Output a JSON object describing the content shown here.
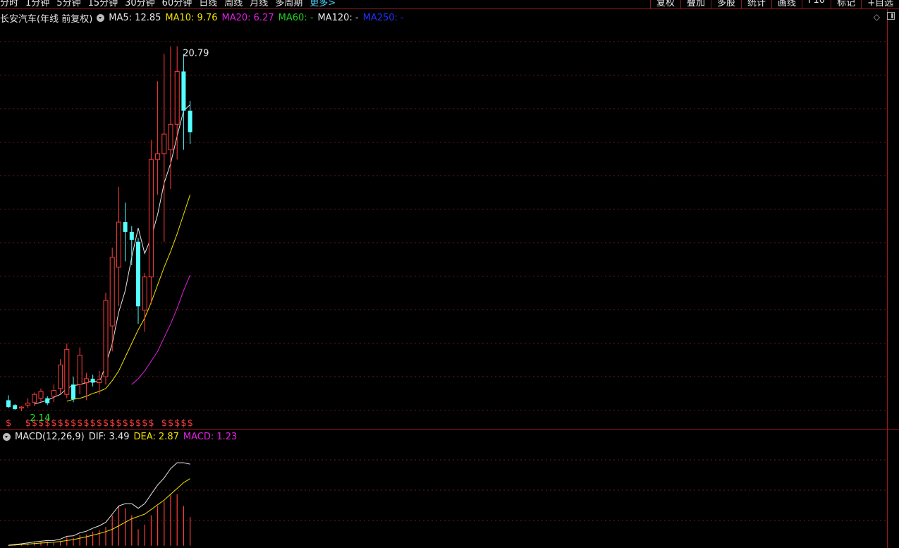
{
  "toolbar": {
    "periods": [
      "分时",
      "1分钟",
      "5分钟",
      "15分钟",
      "30分钟",
      "60分钟",
      "日线",
      "周线",
      "月线",
      "多周期"
    ],
    "more_label": "更多>",
    "tools": [
      "复权",
      "叠加",
      "多股",
      "统计",
      "画线",
      "F10",
      "标记",
      "+自选"
    ]
  },
  "chart": {
    "title": "长安汽车(年线 前复权)",
    "ma_labels": [
      {
        "text": "MA5: 12.85",
        "color": "#e6e6e6"
      },
      {
        "text": "MA10: 9.76",
        "color": "#f0e000"
      },
      {
        "text": "MA20: 6.27",
        "color": "#e020e0"
      },
      {
        "text": "MA60: -",
        "color": "#20d020"
      },
      {
        "text": "MA120: -",
        "color": "#e6e6e6"
      },
      {
        "text": "MA250: -",
        "color": "#2030ff"
      }
    ],
    "high_label": "20.79",
    "low_label": "2.14",
    "colors": {
      "up": "#ff3c3c",
      "down": "#54ffff",
      "grid": "#6e1a1a",
      "border": "#a01818"
    }
  },
  "macd": {
    "name": "MACD(12,26,9)",
    "dif_label": "DIF: 3.49",
    "dea_label": "DEA: 2.87",
    "macd_label": "MACD: 1.23"
  },
  "chart_data": {
    "type": "candlestick",
    "ylim": [
      1.6,
      22.0
    ],
    "candles": [
      {
        "o": 2.7,
        "h": 2.95,
        "l": 2.3,
        "c": 2.35
      },
      {
        "o": 2.45,
        "h": 2.5,
        "l": 2.2,
        "c": 2.25
      },
      {
        "o": 2.3,
        "h": 2.4,
        "l": 2.14,
        "c": 2.35
      },
      {
        "o": 2.45,
        "h": 2.8,
        "l": 2.3,
        "c": 2.55
      },
      {
        "o": 2.6,
        "h": 3.1,
        "l": 2.4,
        "c": 3.0
      },
      {
        "o": 2.8,
        "h": 3.3,
        "l": 2.6,
        "c": 3.15
      },
      {
        "o": 2.8,
        "h": 2.9,
        "l": 2.45,
        "c": 2.55
      },
      {
        "o": 2.9,
        "h": 3.5,
        "l": 2.6,
        "c": 3.2
      },
      {
        "o": 3.3,
        "h": 4.8,
        "l": 3.0,
        "c": 4.5
      },
      {
        "o": 3.0,
        "h": 5.6,
        "l": 2.8,
        "c": 5.3
      },
      {
        "o": 3.5,
        "h": 3.9,
        "l": 2.6,
        "c": 2.75
      },
      {
        "o": 3.5,
        "h": 5.4,
        "l": 3.0,
        "c": 5.0
      },
      {
        "o": 3.6,
        "h": 4.1,
        "l": 2.7,
        "c": 3.8
      },
      {
        "o": 3.8,
        "h": 4.0,
        "l": 3.4,
        "c": 3.6
      },
      {
        "o": 3.6,
        "h": 4.2,
        "l": 3.0,
        "c": 3.75
      },
      {
        "o": 3.9,
        "h": 8.2,
        "l": 3.5,
        "c": 7.8
      },
      {
        "o": 6.5,
        "h": 10.5,
        "l": 5.2,
        "c": 10.0
      },
      {
        "o": 9.5,
        "h": 13.6,
        "l": 7.5,
        "c": 11.8
      },
      {
        "o": 11.8,
        "h": 12.8,
        "l": 9.8,
        "c": 11.3
      },
      {
        "o": 11.3,
        "h": 11.6,
        "l": 9.6,
        "c": 10.9
      },
      {
        "o": 10.8,
        "h": 11.0,
        "l": 6.6,
        "c": 7.5
      },
      {
        "o": 7.3,
        "h": 9.2,
        "l": 6.2,
        "c": 9.0
      },
      {
        "o": 9.0,
        "h": 16.0,
        "l": 7.6,
        "c": 15.0
      },
      {
        "o": 15.0,
        "h": 19.0,
        "l": 13.2,
        "c": 15.3
      },
      {
        "o": 15.3,
        "h": 20.4,
        "l": 10.8,
        "c": 16.3
      },
      {
        "o": 15.5,
        "h": 20.79,
        "l": 13.5,
        "c": 16.8
      },
      {
        "o": 16.8,
        "h": 20.79,
        "l": 15.0,
        "c": 19.5
      },
      {
        "o": 19.5,
        "h": 20.4,
        "l": 15.5,
        "c": 17.5
      },
      {
        "o": 17.5,
        "h": 18.0,
        "l": 15.8,
        "c": 16.4
      }
    ],
    "ma5": [
      null,
      null,
      null,
      null,
      2.5,
      2.6,
      2.7,
      2.85,
      3.0,
      3.3,
      3.45,
      3.5,
      3.6,
      3.7,
      3.6,
      4.5,
      5.6,
      7.2,
      8.3,
      10.0,
      11.5,
      10.2,
      11.0,
      12.2,
      13.8,
      14.8,
      16.2,
      17.5,
      17.8
    ],
    "ma10": [
      null,
      null,
      null,
      null,
      null,
      null,
      null,
      null,
      null,
      2.65,
      2.75,
      2.8,
      2.9,
      3.05,
      3.15,
      3.3,
      3.7,
      4.2,
      4.9,
      5.6,
      6.3,
      6.9,
      7.7,
      8.6,
      9.5,
      10.3,
      11.2,
      12.2,
      13.2
    ],
    "ma20": [
      null,
      null,
      null,
      null,
      null,
      null,
      null,
      null,
      null,
      null,
      null,
      null,
      null,
      null,
      null,
      null,
      null,
      null,
      null,
      3.5,
      3.8,
      4.2,
      4.7,
      5.2,
      5.9,
      6.6,
      7.4,
      8.3,
      9.1
    ],
    "signals": [
      0,
      3,
      4,
      5,
      6,
      7,
      8,
      9,
      10,
      11,
      12,
      13,
      14,
      15,
      16,
      17,
      18,
      19,
      20,
      21,
      22,
      24,
      25,
      26,
      27,
      28
    ],
    "signal_label": "$",
    "macd_dif": [
      0.02,
      0.05,
      0.08,
      0.12,
      0.16,
      0.19,
      0.22,
      0.22,
      0.28,
      0.4,
      0.42,
      0.55,
      0.62,
      0.75,
      0.85,
      1.0,
      1.35,
      1.7,
      1.8,
      1.8,
      1.6,
      1.8,
      2.2,
      2.6,
      2.9,
      3.3,
      3.55,
      3.55,
      3.49
    ],
    "macd_dea": [
      0.01,
      0.03,
      0.05,
      0.07,
      0.09,
      0.11,
      0.13,
      0.15,
      0.18,
      0.22,
      0.26,
      0.32,
      0.38,
      0.45,
      0.52,
      0.6,
      0.7,
      0.85,
      1.0,
      1.15,
      1.25,
      1.35,
      1.55,
      1.75,
      1.95,
      2.2,
      2.45,
      2.7,
      2.87
    ],
    "macd_hist": [
      0.02,
      0.04,
      0.06,
      0.1,
      0.14,
      0.16,
      0.18,
      0.14,
      0.2,
      0.36,
      0.32,
      0.46,
      0.48,
      0.6,
      0.66,
      0.8,
      1.3,
      1.7,
      1.6,
      1.3,
      0.7,
      0.9,
      1.3,
      1.7,
      1.9,
      2.2,
      2.2,
      1.7,
      1.23
    ],
    "macd_ylim": [
      -0.1,
      4.4
    ]
  }
}
